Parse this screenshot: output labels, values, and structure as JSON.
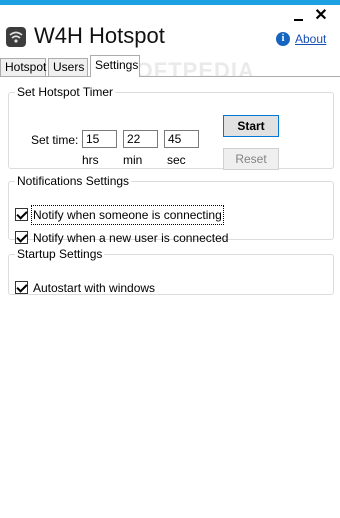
{
  "window": {
    "title": "W4H Hotspot",
    "minimize_symbol": "",
    "close_symbol": "✕",
    "accent_color": "#1ba1e2"
  },
  "header": {
    "about_label": "About",
    "info_icon_glyph": "i"
  },
  "watermark": "SOFTPEDIA",
  "tabs": [
    {
      "label": "Hotspot",
      "active": false
    },
    {
      "label": "Users",
      "active": false
    },
    {
      "label": "Settings",
      "active": true
    }
  ],
  "timer": {
    "legend": "Set Hotspot Timer",
    "set_time_label": "Set time:",
    "hours": "15",
    "minutes": "22",
    "seconds": "45",
    "hrs_label": "hrs",
    "min_label": "min",
    "sec_label": "sec",
    "start_label": "Start",
    "reset_label": "Reset"
  },
  "notifications": {
    "legend": "Notifications Settings",
    "items": [
      {
        "label": "Notify when someone is connecting",
        "checked": true
      },
      {
        "label": "Notify when a new user is connected",
        "checked": true
      }
    ]
  },
  "startup": {
    "legend": "Startup Settings",
    "items": [
      {
        "label": "Autostart with windows",
        "checked": true
      }
    ]
  }
}
